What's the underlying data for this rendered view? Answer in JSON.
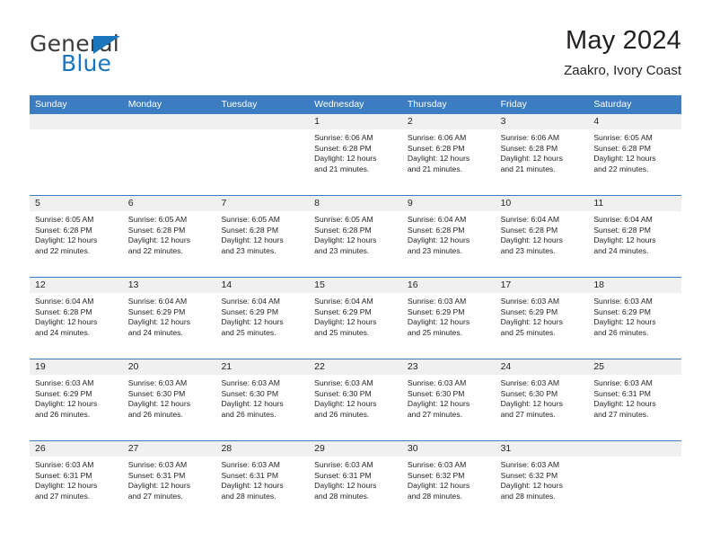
{
  "brand": {
    "name_top": "General",
    "name_bottom": "Blue",
    "accent_color": "#1b75bb"
  },
  "header": {
    "title": "May 2024",
    "subtitle": "Zaakro, Ivory Coast"
  },
  "theme": {
    "header_bar_color": "#3b7dc0",
    "day_strip_color": "#f0f0f0",
    "text_color": "#231f20"
  },
  "weekdays": [
    "Sunday",
    "Monday",
    "Tuesday",
    "Wednesday",
    "Thursday",
    "Friday",
    "Saturday"
  ],
  "weeks": [
    [
      {
        "day": "",
        "empty": true,
        "sunrise": "",
        "sunset": "",
        "daylight_line1": "",
        "daylight_line2": ""
      },
      {
        "day": "",
        "empty": true,
        "sunrise": "",
        "sunset": "",
        "daylight_line1": "",
        "daylight_line2": ""
      },
      {
        "day": "",
        "empty": true,
        "sunrise": "",
        "sunset": "",
        "daylight_line1": "",
        "daylight_line2": ""
      },
      {
        "day": "1",
        "empty": false,
        "sunrise": "Sunrise: 6:06 AM",
        "sunset": "Sunset: 6:28 PM",
        "daylight_line1": "Daylight: 12 hours",
        "daylight_line2": "and 21 minutes."
      },
      {
        "day": "2",
        "empty": false,
        "sunrise": "Sunrise: 6:06 AM",
        "sunset": "Sunset: 6:28 PM",
        "daylight_line1": "Daylight: 12 hours",
        "daylight_line2": "and 21 minutes."
      },
      {
        "day": "3",
        "empty": false,
        "sunrise": "Sunrise: 6:06 AM",
        "sunset": "Sunset: 6:28 PM",
        "daylight_line1": "Daylight: 12 hours",
        "daylight_line2": "and 21 minutes."
      },
      {
        "day": "4",
        "empty": false,
        "sunrise": "Sunrise: 6:05 AM",
        "sunset": "Sunset: 6:28 PM",
        "daylight_line1": "Daylight: 12 hours",
        "daylight_line2": "and 22 minutes."
      }
    ],
    [
      {
        "day": "5",
        "empty": false,
        "sunrise": "Sunrise: 6:05 AM",
        "sunset": "Sunset: 6:28 PM",
        "daylight_line1": "Daylight: 12 hours",
        "daylight_line2": "and 22 minutes."
      },
      {
        "day": "6",
        "empty": false,
        "sunrise": "Sunrise: 6:05 AM",
        "sunset": "Sunset: 6:28 PM",
        "daylight_line1": "Daylight: 12 hours",
        "daylight_line2": "and 22 minutes."
      },
      {
        "day": "7",
        "empty": false,
        "sunrise": "Sunrise: 6:05 AM",
        "sunset": "Sunset: 6:28 PM",
        "daylight_line1": "Daylight: 12 hours",
        "daylight_line2": "and 23 minutes."
      },
      {
        "day": "8",
        "empty": false,
        "sunrise": "Sunrise: 6:05 AM",
        "sunset": "Sunset: 6:28 PM",
        "daylight_line1": "Daylight: 12 hours",
        "daylight_line2": "and 23 minutes."
      },
      {
        "day": "9",
        "empty": false,
        "sunrise": "Sunrise: 6:04 AM",
        "sunset": "Sunset: 6:28 PM",
        "daylight_line1": "Daylight: 12 hours",
        "daylight_line2": "and 23 minutes."
      },
      {
        "day": "10",
        "empty": false,
        "sunrise": "Sunrise: 6:04 AM",
        "sunset": "Sunset: 6:28 PM",
        "daylight_line1": "Daylight: 12 hours",
        "daylight_line2": "and 23 minutes."
      },
      {
        "day": "11",
        "empty": false,
        "sunrise": "Sunrise: 6:04 AM",
        "sunset": "Sunset: 6:28 PM",
        "daylight_line1": "Daylight: 12 hours",
        "daylight_line2": "and 24 minutes."
      }
    ],
    [
      {
        "day": "12",
        "empty": false,
        "sunrise": "Sunrise: 6:04 AM",
        "sunset": "Sunset: 6:28 PM",
        "daylight_line1": "Daylight: 12 hours",
        "daylight_line2": "and 24 minutes."
      },
      {
        "day": "13",
        "empty": false,
        "sunrise": "Sunrise: 6:04 AM",
        "sunset": "Sunset: 6:29 PM",
        "daylight_line1": "Daylight: 12 hours",
        "daylight_line2": "and 24 minutes."
      },
      {
        "day": "14",
        "empty": false,
        "sunrise": "Sunrise: 6:04 AM",
        "sunset": "Sunset: 6:29 PM",
        "daylight_line1": "Daylight: 12 hours",
        "daylight_line2": "and 25 minutes."
      },
      {
        "day": "15",
        "empty": false,
        "sunrise": "Sunrise: 6:04 AM",
        "sunset": "Sunset: 6:29 PM",
        "daylight_line1": "Daylight: 12 hours",
        "daylight_line2": "and 25 minutes."
      },
      {
        "day": "16",
        "empty": false,
        "sunrise": "Sunrise: 6:03 AM",
        "sunset": "Sunset: 6:29 PM",
        "daylight_line1": "Daylight: 12 hours",
        "daylight_line2": "and 25 minutes."
      },
      {
        "day": "17",
        "empty": false,
        "sunrise": "Sunrise: 6:03 AM",
        "sunset": "Sunset: 6:29 PM",
        "daylight_line1": "Daylight: 12 hours",
        "daylight_line2": "and 25 minutes."
      },
      {
        "day": "18",
        "empty": false,
        "sunrise": "Sunrise: 6:03 AM",
        "sunset": "Sunset: 6:29 PM",
        "daylight_line1": "Daylight: 12 hours",
        "daylight_line2": "and 26 minutes."
      }
    ],
    [
      {
        "day": "19",
        "empty": false,
        "sunrise": "Sunrise: 6:03 AM",
        "sunset": "Sunset: 6:29 PM",
        "daylight_line1": "Daylight: 12 hours",
        "daylight_line2": "and 26 minutes."
      },
      {
        "day": "20",
        "empty": false,
        "sunrise": "Sunrise: 6:03 AM",
        "sunset": "Sunset: 6:30 PM",
        "daylight_line1": "Daylight: 12 hours",
        "daylight_line2": "and 26 minutes."
      },
      {
        "day": "21",
        "empty": false,
        "sunrise": "Sunrise: 6:03 AM",
        "sunset": "Sunset: 6:30 PM",
        "daylight_line1": "Daylight: 12 hours",
        "daylight_line2": "and 26 minutes."
      },
      {
        "day": "22",
        "empty": false,
        "sunrise": "Sunrise: 6:03 AM",
        "sunset": "Sunset: 6:30 PM",
        "daylight_line1": "Daylight: 12 hours",
        "daylight_line2": "and 26 minutes."
      },
      {
        "day": "23",
        "empty": false,
        "sunrise": "Sunrise: 6:03 AM",
        "sunset": "Sunset: 6:30 PM",
        "daylight_line1": "Daylight: 12 hours",
        "daylight_line2": "and 27 minutes."
      },
      {
        "day": "24",
        "empty": false,
        "sunrise": "Sunrise: 6:03 AM",
        "sunset": "Sunset: 6:30 PM",
        "daylight_line1": "Daylight: 12 hours",
        "daylight_line2": "and 27 minutes."
      },
      {
        "day": "25",
        "empty": false,
        "sunrise": "Sunrise: 6:03 AM",
        "sunset": "Sunset: 6:31 PM",
        "daylight_line1": "Daylight: 12 hours",
        "daylight_line2": "and 27 minutes."
      }
    ],
    [
      {
        "day": "26",
        "empty": false,
        "sunrise": "Sunrise: 6:03 AM",
        "sunset": "Sunset: 6:31 PM",
        "daylight_line1": "Daylight: 12 hours",
        "daylight_line2": "and 27 minutes."
      },
      {
        "day": "27",
        "empty": false,
        "sunrise": "Sunrise: 6:03 AM",
        "sunset": "Sunset: 6:31 PM",
        "daylight_line1": "Daylight: 12 hours",
        "daylight_line2": "and 27 minutes."
      },
      {
        "day": "28",
        "empty": false,
        "sunrise": "Sunrise: 6:03 AM",
        "sunset": "Sunset: 6:31 PM",
        "daylight_line1": "Daylight: 12 hours",
        "daylight_line2": "and 28 minutes."
      },
      {
        "day": "29",
        "empty": false,
        "sunrise": "Sunrise: 6:03 AM",
        "sunset": "Sunset: 6:31 PM",
        "daylight_line1": "Daylight: 12 hours",
        "daylight_line2": "and 28 minutes."
      },
      {
        "day": "30",
        "empty": false,
        "sunrise": "Sunrise: 6:03 AM",
        "sunset": "Sunset: 6:32 PM",
        "daylight_line1": "Daylight: 12 hours",
        "daylight_line2": "and 28 minutes."
      },
      {
        "day": "31",
        "empty": false,
        "sunrise": "Sunrise: 6:03 AM",
        "sunset": "Sunset: 6:32 PM",
        "daylight_line1": "Daylight: 12 hours",
        "daylight_line2": "and 28 minutes."
      },
      {
        "day": "",
        "empty": true,
        "sunrise": "",
        "sunset": "",
        "daylight_line1": "",
        "daylight_line2": ""
      }
    ]
  ]
}
